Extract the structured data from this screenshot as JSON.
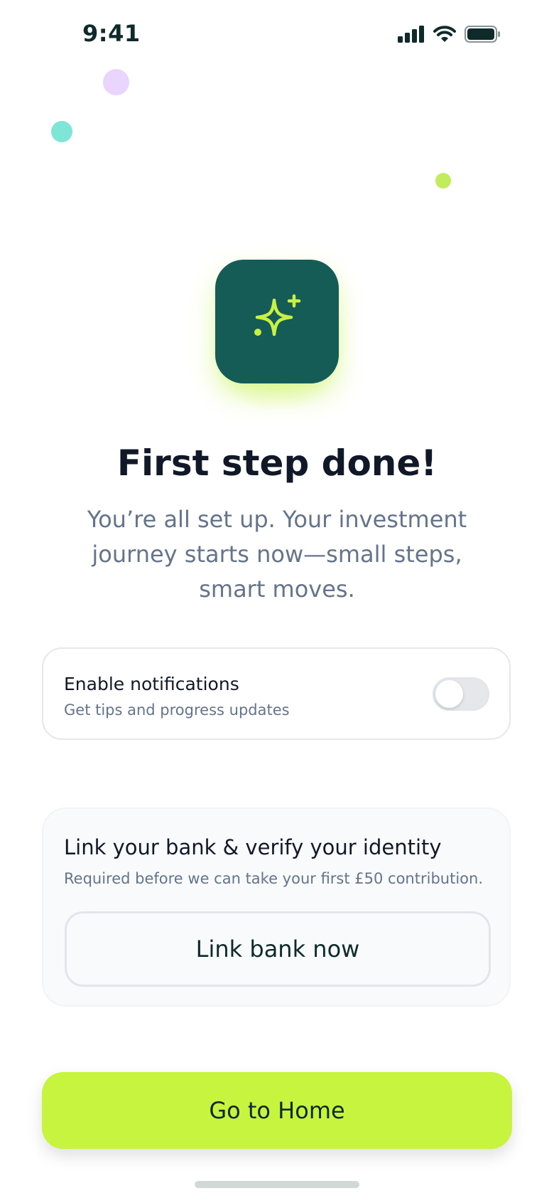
{
  "status_bar": {
    "time": "9:41",
    "signal_icon": "signal-bars-icon",
    "wifi_icon": "wifi-icon",
    "battery_icon": "battery-icon"
  },
  "hero": {
    "icon": "sparkle-icon",
    "title": "First step done!",
    "subtitle": "You’re all set up. Your investment journey starts now—small steps, smart moves."
  },
  "notifications": {
    "title": "Enable notifications",
    "subtitle": "Get tips and progress updates",
    "enabled": false
  },
  "bank": {
    "title": "Link your bank & verify your identity",
    "subtitle": "Required before we can take your first £50 contribution.",
    "button_label": "Link bank now"
  },
  "primary_action": {
    "label": "Go to Home"
  },
  "colors": {
    "accent": "#c6f43f",
    "brand_dark": "#145c55",
    "sparkle": "#c8f045"
  }
}
